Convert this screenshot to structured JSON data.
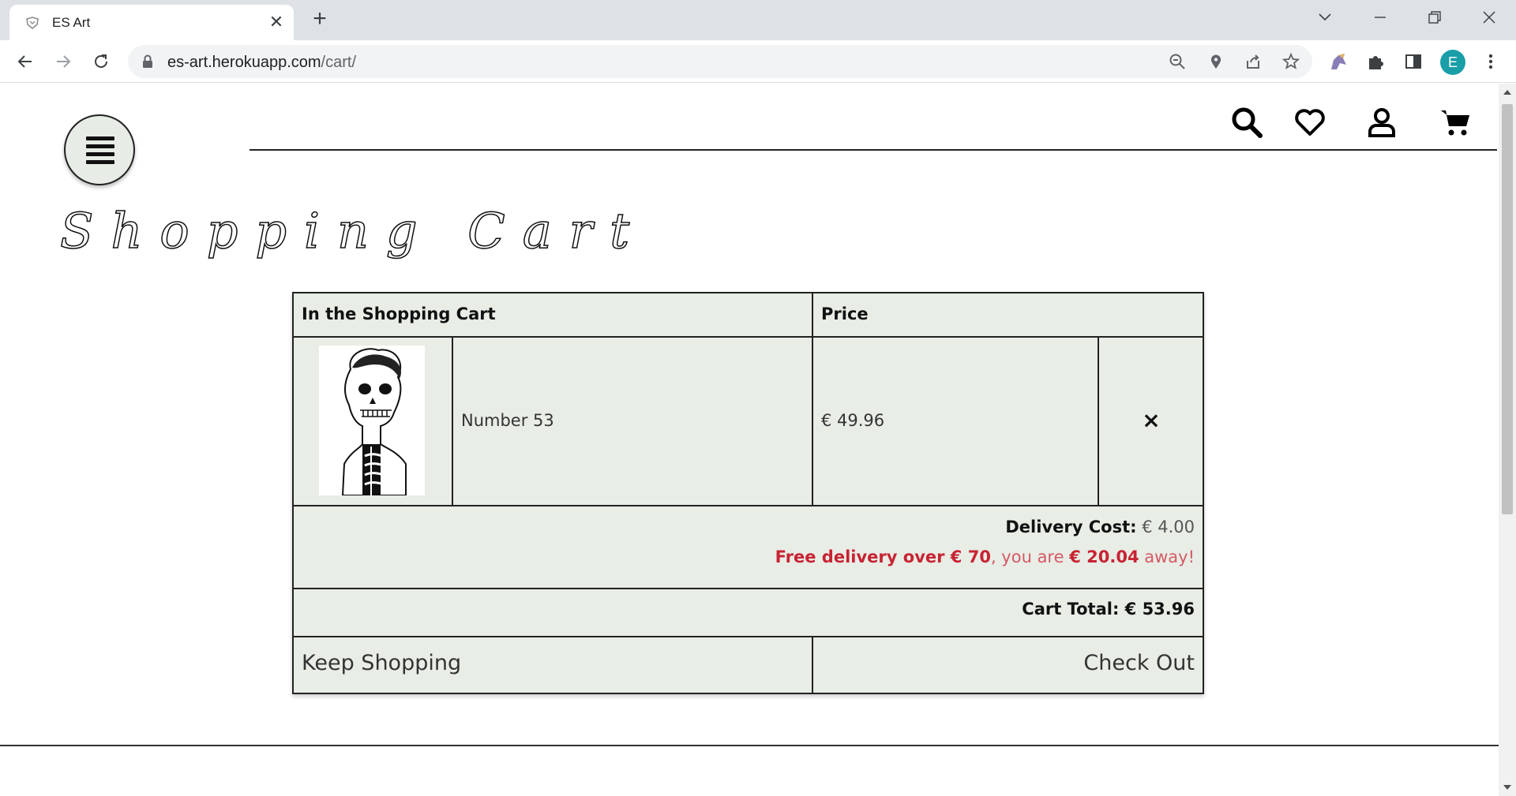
{
  "browser": {
    "tab_title": "ES Art",
    "url_host": "es-art.herokuapp.com",
    "url_path": "/cart/",
    "profile_initial": "E"
  },
  "header": {
    "icons": [
      "menu-icon",
      "search-icon",
      "heart-icon",
      "user-icon",
      "cart-icon"
    ]
  },
  "page": {
    "title": "Shopping Cart"
  },
  "cart": {
    "col_item": "In the Shopping Cart",
    "col_price": "Price",
    "items": [
      {
        "name": "Number 53",
        "price": "€ 49.96",
        "remove": "×"
      }
    ],
    "delivery_label": "Delivery Cost:",
    "delivery_value": "€ 4.00",
    "free_delivery_prefix": "Free delivery over € 70",
    "free_delivery_mid": ", you are ",
    "free_delivery_amount": "€ 20.04",
    "free_delivery_suffix": " away!",
    "total_label": "Cart Total: € 53.96",
    "keep_shopping": "Keep Shopping",
    "check_out": "Check Out"
  },
  "colors": {
    "panel_bg": "#e8ede6",
    "alert_red": "#c82333",
    "profile_teal": "#1a9ea8"
  }
}
